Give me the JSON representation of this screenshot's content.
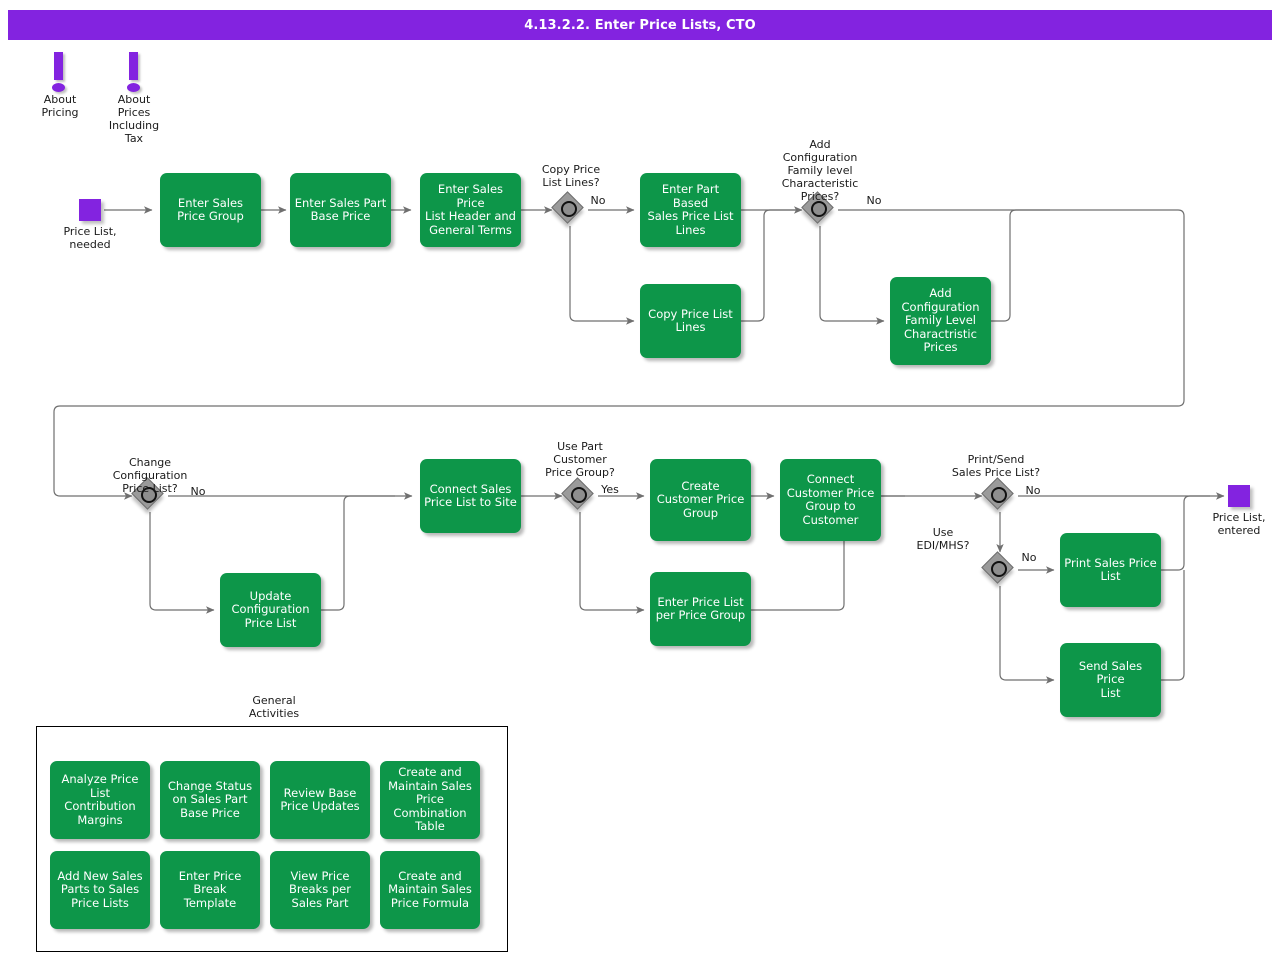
{
  "header": {
    "title": "4.13.2.2. Enter Price Lists, CTO",
    "bar_color": "#8323e0"
  },
  "palette": {
    "task_green": "#0d9649",
    "event_purple": "#8323e0",
    "gateway_gray": "#9a9a9a",
    "connector_gray": "#6f6f6f",
    "text_light": "#ffffff",
    "text_dark": "#1a1a1a"
  },
  "info_markers": [
    {
      "id": "about-pricing",
      "label": "About\nPricing",
      "icon": "exclamation-icon"
    },
    {
      "id": "about-prices-including-tax",
      "label": "About\nPrices\nIncluding\nTax",
      "icon": "exclamation-icon"
    }
  ],
  "events": [
    {
      "id": "start-price-list-needed",
      "label": "Price List,\nneeded",
      "type": "start"
    },
    {
      "id": "end-price-list-entered",
      "label": "Price List,\nentered",
      "type": "end"
    }
  ],
  "gateways": [
    {
      "id": "copy-price-list-lines",
      "question": "Copy Price\nList Lines?",
      "branch_label": "No"
    },
    {
      "id": "add-configuration-family-level-characteristic-prices",
      "question": "Add\nConfiguration\nFamily level\nCharacteristic\nPrices?",
      "branch_label": "No"
    },
    {
      "id": "change-configuration-price-list",
      "question": "Change\nConfiguration\nPrice List?",
      "branch_label": "No"
    },
    {
      "id": "use-part-customer-price-group",
      "question": "Use Part\nCustomer\nPrice Group?",
      "branch_label": "Yes"
    },
    {
      "id": "print-send-sales-price-list",
      "question": "Print/Send\nSales Price List?",
      "branch_label": "No"
    },
    {
      "id": "use-edi-mhs",
      "question": "Use\nEDI/MHS?",
      "branch_label": "No"
    }
  ],
  "tasks": {
    "enter_sales_price_group": "Enter Sales\nPrice Group",
    "enter_sales_part_base_price": "Enter Sales Part\nBase Price",
    "enter_sales_price_list_header_and_general_terms": "Enter Sales Price\nList Header and\nGeneral Terms",
    "enter_part_based_sales_price_list_lines": "Enter Part Based\nSales Price List\nLines",
    "copy_price_list_lines": "Copy Price List\nLines",
    "add_configuration_family_level_charactristic_prices": "Add\nConfiguration\nFamily Level\nCharactristic\nPrices",
    "update_configuration_price_list": "Update\nConfiguration\nPrice List",
    "connect_sales_price_list_to_site": "Connect Sales\nPrice List to Site",
    "create_customer_price_group": "Create\nCustomer Price\nGroup",
    "connect_customer_price_group_to_customer": "Connect\nCustomer Price\nGroup to\nCustomer",
    "enter_price_list_per_price_group": "Enter Price List\nper Price Group",
    "print_sales_price_list": "Print Sales Price\nList",
    "send_sales_price_list": "Send Sales Price\nList"
  },
  "general_activities": {
    "title": "General\nActivities",
    "items": [
      "Analyze Price\nList Contribution\nMargins",
      "Change Status\non Sales Part\nBase Price",
      "Review Base\nPrice Updates",
      "Create and\nMaintain Sales\nPrice\nCombination\nTable",
      "Add New Sales\nParts to Sales\nPrice Lists",
      "Enter Price Break\nTemplate",
      "View Price\nBreaks per\nSales Part",
      "Create and\nMaintain Sales\nPrice Formula"
    ]
  }
}
